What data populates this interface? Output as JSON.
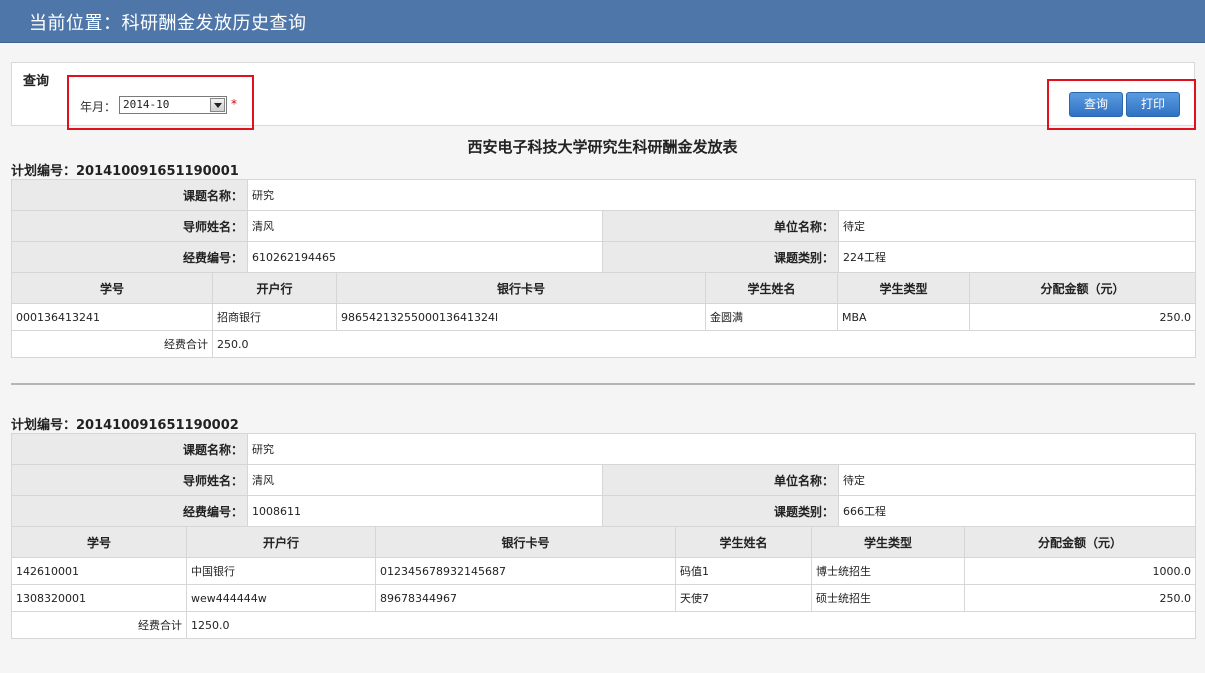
{
  "header": {
    "breadcrumb": "当前位置：科研酬金发放历史查询"
  },
  "query": {
    "title": "查询",
    "year_month_label": "年月：",
    "year_month_value": "2014-10",
    "required_mark": "*",
    "search_label": "查询",
    "print_label": "打印"
  },
  "report": {
    "title": "西安电子科技大学研究生科研酬金发放表",
    "labels": {
      "topic_name": "课题名称：",
      "tutor_name": "导师姓名：",
      "unit_name": "单位名称：",
      "fund_no": "经费编号：",
      "topic_type": "课题类别：",
      "col_student_no": "学号",
      "col_bank": "开户行",
      "col_card": "银行卡号",
      "col_student_name": "学生姓名",
      "col_student_type": "学生类型",
      "col_amount": "分配金额（元）",
      "total": "经费合计"
    },
    "plans": [
      {
        "plan_no": "计划编号：201410091651190001",
        "topic_name": "研究",
        "tutor_name": "清风",
        "unit_name": "待定",
        "fund_no": "610262194465",
        "topic_type": "224工程",
        "students": [
          {
            "no": "000136413241",
            "bank": "招商银行",
            "card": "9865421325500013641324l",
            "name": "金圆满",
            "type": "MBA",
            "amount": "250.0"
          }
        ],
        "total": "250.0"
      },
      {
        "plan_no": "计划编号：201410091651190002",
        "topic_name": "研究",
        "tutor_name": "清风",
        "unit_name": "待定",
        "fund_no": "1008611",
        "topic_type": "666工程",
        "students": [
          {
            "no": "142610001",
            "bank": "中国银行",
            "card": "012345678932145687",
            "name": "码值1",
            "type": "博士统招生",
            "amount": "1000.0"
          },
          {
            "no": "1308320001",
            "bank": "wew444444w",
            "card": "89678344967",
            "name": "天使7",
            "type": "硕士统招生",
            "amount": "250.0"
          }
        ],
        "total": "1250.0"
      }
    ]
  }
}
